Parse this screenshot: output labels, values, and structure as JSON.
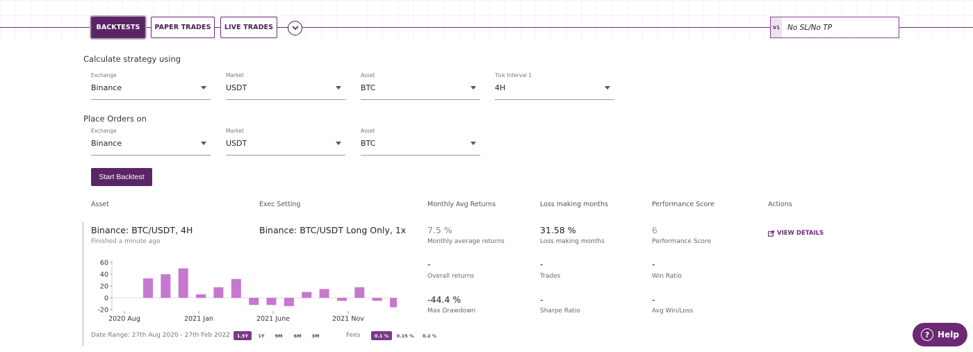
{
  "tabs": [
    {
      "label": "BACKTESTS",
      "active": true
    },
    {
      "label": "PAPER TRADES",
      "active": false
    },
    {
      "label": "LIVE TRADES",
      "active": false
    }
  ],
  "strategy": {
    "version": "V1",
    "name": "No SL/No TP"
  },
  "calculate": {
    "title": "Calculate strategy using",
    "fields": [
      {
        "label": "Exchange",
        "value": "Binance"
      },
      {
        "label": "Market",
        "value": "USDT"
      },
      {
        "label": "Asset",
        "value": "BTC"
      },
      {
        "label": "Tick Interval 1",
        "value": "4H"
      }
    ]
  },
  "orders": {
    "title": "Place Orders on",
    "fields": [
      {
        "label": "Exchange",
        "value": "Binance"
      },
      {
        "label": "Market",
        "value": "USDT"
      },
      {
        "label": "Asset",
        "value": "BTC"
      }
    ]
  },
  "start_button": "Start Backtest",
  "table": {
    "headers": [
      "Asset",
      "Exec Setting",
      "Monthly Avg Returns",
      "Loss making months",
      "Performance Score",
      "Actions"
    ],
    "row": {
      "asset": "Binance: BTC/USDT, 4H",
      "finished": "Finished a minute ago",
      "exec": "Binance: BTC/USDT Long Only, 1x",
      "metrics": {
        "monthly_avg": {
          "value": "7.5 %",
          "label": "Monthly average returns"
        },
        "loss_months": {
          "value": "31.58 %",
          "label": "Loss making months"
        },
        "perf_score": {
          "value": "6",
          "label": "Performance Score"
        },
        "overall": {
          "value": "-",
          "label": "Overall returns"
        },
        "trades": {
          "value": "-",
          "label": "Trades"
        },
        "win_ratio": {
          "value": "-",
          "label": "Win Ratio"
        },
        "max_dd": {
          "value": "-44.4 %",
          "label": "Max Drawdown"
        },
        "sharpe": {
          "value": "-",
          "label": "Sharpe Ratio"
        },
        "avg_wl": {
          "value": "-",
          "label": "Avg Win/Loss"
        }
      },
      "view_details": "VIEW DETAILS"
    }
  },
  "chart_data": {
    "type": "bar",
    "values": [
      33,
      40,
      50,
      6,
      18,
      32,
      -12,
      -12,
      -14,
      10,
      15,
      -5,
      18,
      -5,
      -16
    ],
    "x_tick_labels": [
      "2020 Aug",
      "2021 Jan",
      "2021 June",
      "2021 Nov"
    ],
    "y_ticks": [
      60,
      40,
      20,
      0,
      -20
    ],
    "ylim": [
      -20,
      60
    ],
    "bar_color": "#c678d0"
  },
  "date_range": "Date Range: 27th Aug 2020 - 27th Feb 2022",
  "period_options": [
    {
      "label": "1.5Y",
      "selected": true
    },
    {
      "label": "1Y",
      "selected": false
    },
    {
      "label": "9M",
      "selected": false
    },
    {
      "label": "6M",
      "selected": false
    },
    {
      "label": "3M",
      "selected": false
    }
  ],
  "fees_label": "Fees",
  "fee_options": [
    {
      "label": "0.1 %",
      "selected": true
    },
    {
      "label": "0.15 %",
      "selected": false
    },
    {
      "label": "0.2 %",
      "selected": false
    }
  ],
  "help_label": "Help",
  "colors": {
    "brand": "#5a2565",
    "accent": "#6b2a73",
    "bar": "#c678d0"
  }
}
